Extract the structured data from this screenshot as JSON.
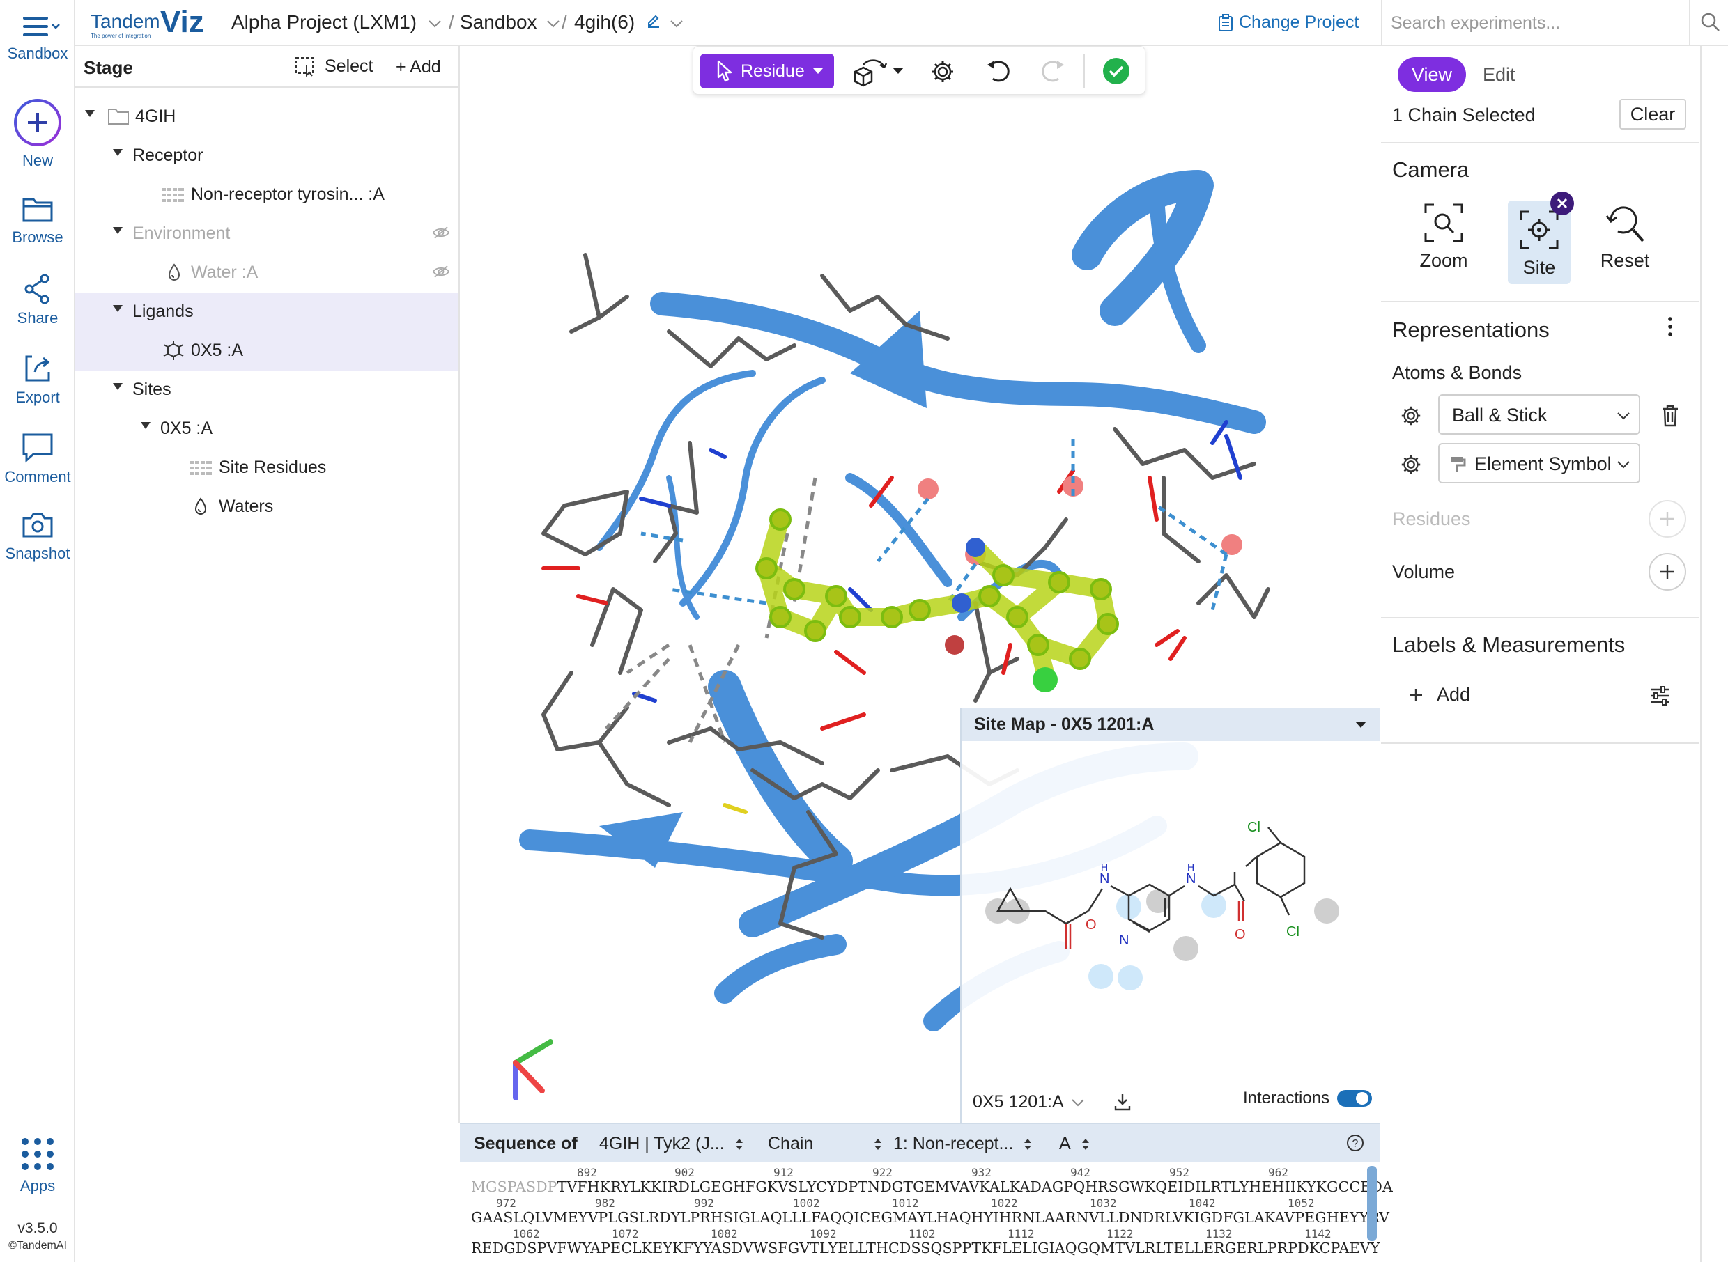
{
  "app": {
    "logo_text": "TandemViz",
    "logo_tagline": "The power of integration",
    "version": "v3.5.0",
    "copyright": "©TandemAI"
  },
  "header": {
    "menu_label": "Sandbox",
    "breadcrumbs": [
      "Alpha Project (LXM1)",
      "Sandbox",
      "4gih(6)"
    ],
    "change_project": "Change Project",
    "search_placeholder": "Search experiments..."
  },
  "rail": {
    "items": [
      {
        "label": "New",
        "icon": "plus-circle-icon"
      },
      {
        "label": "Browse",
        "icon": "folder-icon"
      },
      {
        "label": "Share",
        "icon": "share-icon"
      },
      {
        "label": "Export",
        "icon": "export-icon"
      },
      {
        "label": "Comment",
        "icon": "comment-icon"
      },
      {
        "label": "Snapshot",
        "icon": "camera-icon"
      }
    ],
    "apps_label": "Apps"
  },
  "stage": {
    "title": "Stage",
    "select_label": "Select",
    "add_label": "+ Add",
    "tree": [
      {
        "label": "4GIH"
      },
      {
        "label": "Receptor"
      },
      {
        "label": "Non-receptor tyrosin... :A"
      },
      {
        "label": "Environment"
      },
      {
        "label": "Water :A"
      },
      {
        "label": "Ligands"
      },
      {
        "label": "0X5 :A"
      },
      {
        "label": "Sites"
      },
      {
        "label": "0X5 :A"
      },
      {
        "label": "Site Residues"
      },
      {
        "label": "Waters"
      }
    ]
  },
  "toolbar": {
    "residue_label": "Residue",
    "confirm_color": "#22b14c"
  },
  "sitemap": {
    "title": "Site Map - 0X5 1201:A",
    "ligand_select": "0X5 1201:A",
    "interactions_label": "Interactions",
    "interactions_on": true,
    "atom_labels": [
      "H",
      "H",
      "O",
      "N",
      "O",
      "Cl",
      "Cl"
    ]
  },
  "sequence": {
    "label": "Sequence of",
    "structure_select": "4GIH | Tyk2 (J...",
    "mode_select": "Chain",
    "chain_select": "1: Non-recept...",
    "chain_id_select": "A",
    "lines": [
      {
        "numbers": [
          "892",
          "902",
          "912",
          "922",
          "932",
          "942",
          "952",
          "962"
        ],
        "prefix": "MGSPASDP",
        "text": "TVFHKRYLKKIRDLGEGHFGKVSLYCYDPTNDGTGEMVAVKALKADAGPQHRSGWKQEIDILRTLYHEHIIKYKGCCEDA"
      },
      {
        "numbers": [
          "972",
          "982",
          "992",
          "1002",
          "1012",
          "1022",
          "1032",
          "1042",
          "1052"
        ],
        "prefix": "",
        "text": "GAASLQLVMEYVPLGSLRDYLPRHSIGLAQLLLFAQQICEGMAYLHAQHYIHRNLAARNVLLDNDRLVKIGDFGLAKAVPEGHEYYRV"
      },
      {
        "numbers": [
          "1062",
          "1072",
          "1082",
          "1092",
          "1102",
          "1112",
          "1122",
          "1132",
          "1142"
        ],
        "prefix": "",
        "text": "REDGDSPVFWYAPECLKEYKFYYASDVWSFGVTLYELLTHCDSSQSPPTKFLELIGIAQGQMTVLRLTELLERGERLPRPDKCPAEVY"
      }
    ]
  },
  "right": {
    "view_label": "View",
    "edit_label": "Edit",
    "selection_text": "1 Chain Selected",
    "clear_label": "Clear",
    "camera_title": "Camera",
    "camera_buttons": [
      "Zoom",
      "Site",
      "Reset"
    ],
    "representations_title": "Representations",
    "atoms_bonds_label": "Atoms & Bonds",
    "style_select": "Ball & Stick",
    "color_select": "Element Symbol",
    "residues_label": "Residues",
    "volume_label": "Volume",
    "labels_title": "Labels & Measurements",
    "add_label": "Add"
  },
  "colors": {
    "accent": "#7e2ee0",
    "brand_blue": "#1b5c9e",
    "ribbon": "#4a90d9",
    "ligand": "#b8d41a"
  }
}
